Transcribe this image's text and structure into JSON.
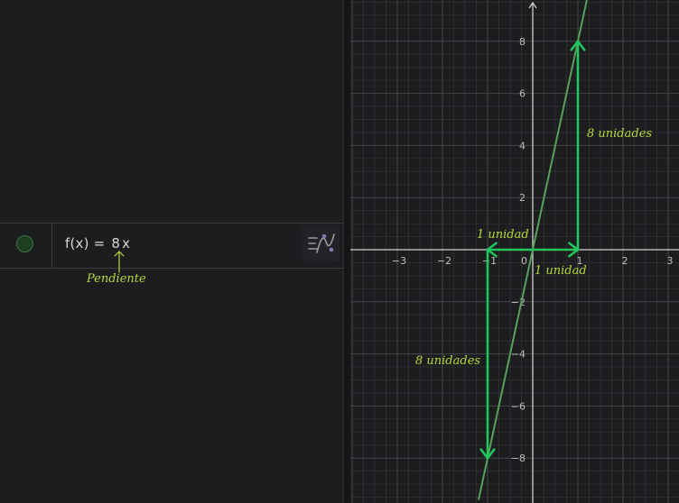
{
  "algebra": {
    "function_name": "f(x)",
    "equals": "=",
    "slope": "8",
    "variable": "x",
    "visibility_color": "#1c3f22",
    "slope_annotation": "Pendiente",
    "annotation_color": "#b7d83b"
  },
  "graphics": {
    "background": "#1c1d1f",
    "x_ticks": [
      "−3",
      "−2",
      "−1",
      "0",
      "1",
      "2",
      "3"
    ],
    "y_ticks": [
      "8",
      "6",
      "4",
      "2",
      "−2",
      "−4",
      "−6",
      "−8"
    ],
    "line_color": "#59a05c",
    "arrow_color": "#22c55e",
    "label_color": "#b7d83b",
    "labels": {
      "top_right_rise": "8 unidades",
      "left_run": "1 unidad",
      "right_run": "1 unidad",
      "bottom_left_drop": "8 unidades"
    }
  },
  "chart_data": {
    "type": "line",
    "title": "",
    "xlabel": "",
    "ylabel": "",
    "xlim": [
      -4,
      3.2
    ],
    "ylim": [
      -9.6,
      9.4
    ],
    "grid": true,
    "series": [
      {
        "x": [
          -1.2,
          1.2
        ],
        "y": [
          -9.6,
          9.6
        ]
      }
    ],
    "annotations": [
      {
        "kind": "arrow",
        "from": [
          0,
          0
        ],
        "to": [
          1,
          0
        ],
        "text": "1 unidad"
      },
      {
        "kind": "arrow",
        "from": [
          1,
          0
        ],
        "to": [
          1,
          8
        ],
        "text": "8 unidades"
      },
      {
        "kind": "arrow",
        "from": [
          0,
          0
        ],
        "to": [
          -1,
          0
        ],
        "text": "1 unidad"
      },
      {
        "kind": "arrow",
        "from": [
          -1,
          0
        ],
        "to": [
          -1,
          -8
        ],
        "text": "8 unidades"
      }
    ]
  }
}
